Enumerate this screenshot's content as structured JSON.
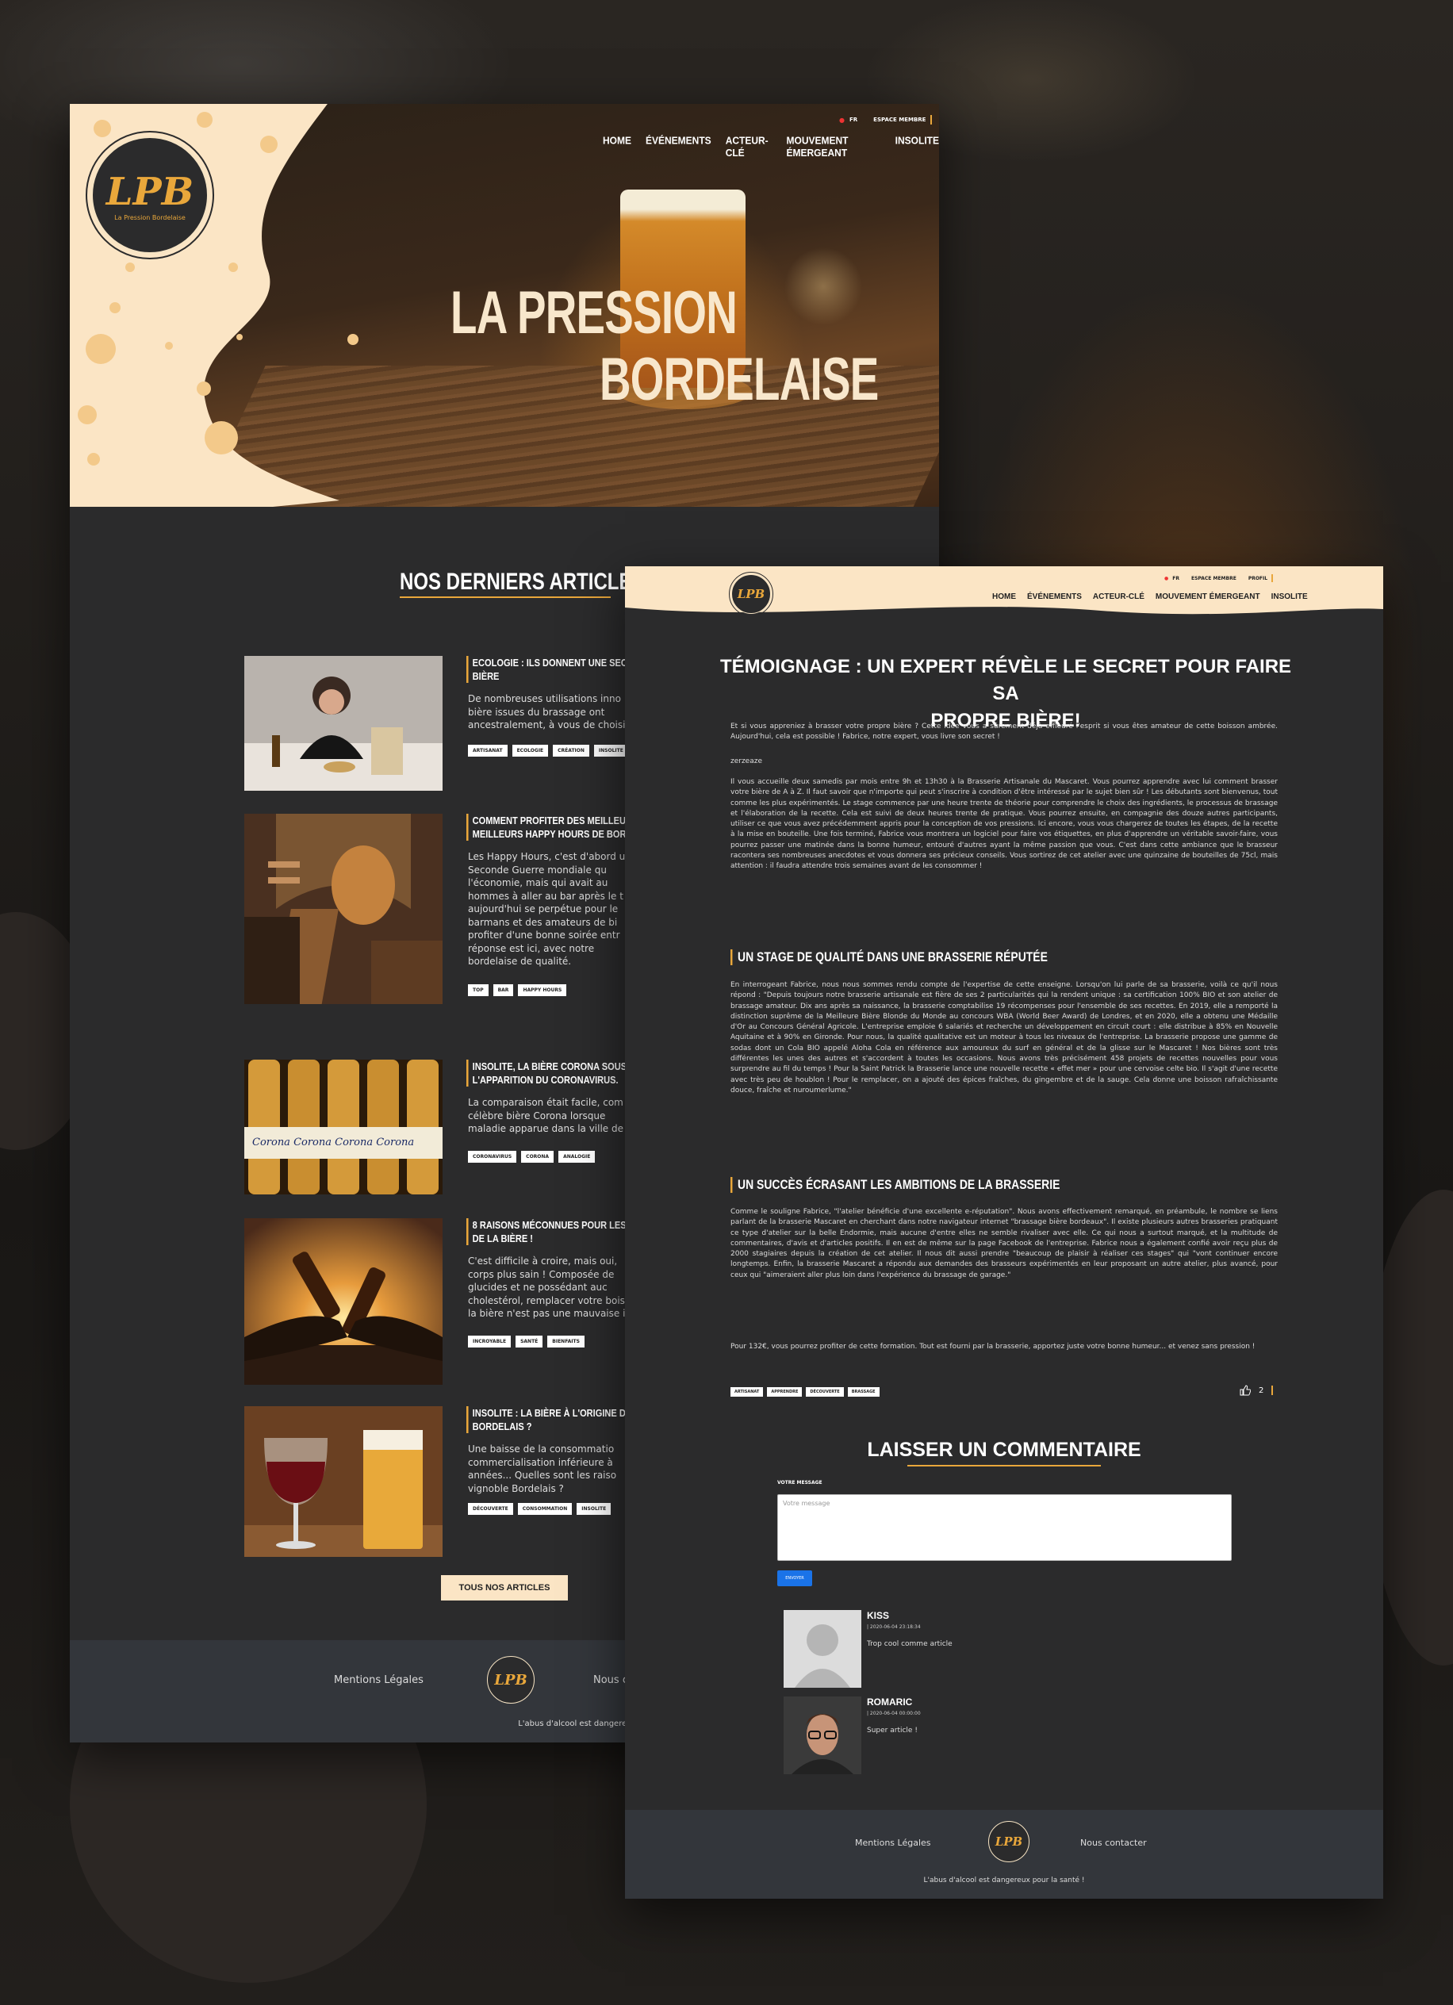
{
  "brand": {
    "logo_text": "LPB",
    "tagline": "La Pression Bordelaise"
  },
  "colors": {
    "accent": "#e9a73b",
    "cream": "#fbe5c5",
    "dark": "#2b2b2c",
    "footer": "#33363b"
  },
  "topbar": {
    "lang": "FR",
    "lang_icon": "flag-icon",
    "member": "ESPACE MEMBRE",
    "member_short": "ESPACE MEMBRE",
    "profile": "PROFIL"
  },
  "nav": [
    "HOME",
    "ÉVÉNEMENTS",
    "ACTEUR-CLÉ",
    "MOUVEMENT ÉMERGEANT",
    "INSOLITE"
  ],
  "hero": {
    "line1": "LA PRESSION",
    "line2": "BORDELAISE"
  },
  "home": {
    "section_title": "NOS DERNIERS ARTICLES",
    "articles": [
      {
        "title": "ECOLOGIE : ILS DONNENT UNE SECOND\nBIÈRE",
        "excerpt": "De nombreuses utilisations inno\nbière issues du brassage ont\nancestralement, à vous de choisir !",
        "tags": [
          "ARTISANAT",
          "ECOLOGIE",
          "CRÉATION",
          "INSOLITE"
        ]
      },
      {
        "title": "COMMENT PROFITER DES MEILLEU\nMEILLEURS HAPPY HOURS DE BOR",
        "excerpt": "Les Happy Hours, c'est d'abord u\nSeconde Guerre mondiale qu\nl'économie, mais qui avait au\nhommes à aller au bar après le t\naujourd'hui se perpétue pour le\nbarmans et des amateurs de bi\nprofiter d'une bonne soirée entr\nréponse est ici, avec notre\nbordelaise de qualité.",
        "tags": [
          "TOP",
          "BAR",
          "HAPPY HOURS"
        ]
      },
      {
        "title": "INSOLITE, LA BIÈRE CORONA SOUS\nL'APPARITION DU CORONAVIRUS.",
        "excerpt": "La comparaison était facile, com\ncélèbre bière Corona lorsque\nmaladie apparue dans la ville de W",
        "tags": [
          "CORONAVIRUS",
          "CORONA",
          "ANALOGIE"
        ]
      },
      {
        "title": "8 RAISONS MÉCONNUES POUR LES\nDE LA BIÈRE !",
        "excerpt": "C'est difficile à croire, mais oui,\ncorps plus sain ! Composée de\nglucides et ne possédant auc\ncholestérol, remplacer votre bois\nla bière n'est pas une mauvaise id",
        "tags": [
          "INCROYABLE",
          "SANTÉ",
          "BIENFAITS"
        ]
      },
      {
        "title": "INSOLITE : LA BIÈRE À L'ORIGINE D\nBORDELAIS ?",
        "excerpt": "Une baisse de la consommatio\ncommercialisation inférieure à\nannées... Quelles sont les raiso\nvignoble Bordelais ?",
        "tags": [
          "DÉCOUVERTE",
          "CONSOMMATION",
          "INSOLITE"
        ]
      }
    ],
    "all_button": "TOUS NOS ARTICLES",
    "footer": {
      "legal": "Mentions Légales",
      "contact": "Nous c",
      "warning": "L'abus d'alcool est dangereux pour la santé !"
    }
  },
  "post": {
    "title_l1": "TÉMOIGNAGE : UN EXPERT RÉVÈLE LE SECRET POUR FAIRE SA",
    "title_l2": "PROPRE BIÈRE!",
    "intro": "Et si vous appreniez à brasser votre propre bière ? Cette idée vous a sûrement déjà effleuré l'esprit si vous êtes amateur de cette boisson ambrée. Aujourd'hui, cela est possible ! Fabrice, notre expert, vous livre son secret !",
    "intro2": "zerzeaze",
    "p1": "Il vous accueille deux samedis par mois entre 9h et 13h30 à la Brasserie Artisanale du Mascaret. Vous pourrez apprendre avec lui comment brasser votre bière de A à Z. Il faut savoir que n'importe qui peut s'inscrire à condition d'être intéressé par le sujet bien sûr ! Les débutants sont bienvenus, tout comme les plus expérimentés. Le stage commence par une heure trente de théorie pour comprendre le choix des ingrédients, le processus de brassage et l'élaboration de la recette. Cela est suivi de deux heures trente de pratique. Vous pourrez ensuite, en compagnie des douze autres participants, utiliser ce que vous avez précédemment appris pour la conception de vos pressions. Ici encore, vous vous chargerez de toutes les étapes, de la recette à la mise en bouteille. Une fois terminé, Fabrice vous montrera un logiciel pour faire vos étiquettes, en plus d'apprendre un véritable savoir-faire, vous pourrez passer une matinée dans la bonne humeur, entouré d'autres ayant la même passion que vous. C'est dans cette ambiance que le brasseur racontera ses nombreuses anecdotes et vous donnera ses précieux conseils. Vous sortirez de cet atelier avec une quinzaine de bouteilles de 75cl, mais attention : il faudra attendre trois semaines avant de les consommer !",
    "h_stage": "UN STAGE DE QUALITÉ DANS UNE BRASSERIE RÉPUTÉE",
    "p2": "En interrogeant Fabrice, nous nous sommes rendu compte de l'expertise de cette enseigne. Lorsqu'on lui parle de sa brasserie, voilà ce qu'il nous répond : \"Depuis toujours notre brasserie artisanale est fière de ses 2 particularités qui la rendent unique : sa certification 100% BIO et son atelier de brassage amateur. Dix ans après sa naissance, la brasserie comptabilise 19 récompenses pour l'ensemble de ses recettes. En 2019, elle a remporté la distinction suprême de la Meilleure Bière Blonde du Monde au concours WBA (World Beer Award) de Londres, et en 2020, elle a obtenu une Médaille d'Or au Concours Général Agricole. L'entreprise emploie 6 salariés et recherche un développement en circuit court : elle distribue à 85% en Nouvelle Aquitaine et à 90% en Gironde. Pour nous, la qualité qualitative est un moteur à tous les niveaux de l'entreprise. La brasserie propose une gamme de sodas dont un Cola BIO appelé Aloha Cola en référence aux amoureux du surf en général et de la glisse sur le Mascaret ! Nos bières sont très différentes les unes des autres et s'accordent à toutes les occasions. Nous avons très précisément 458 projets de recettes nouvelles pour vous surprendre au fil du temps ! Pour la Saint Patrick la Brasserie lance une nouvelle recette « effet mer » pour une cervoise celte bio. Il s'agit d'une recette avec très peu de houblon ! Pour le remplacer, on a ajouté des épices fraîches, du gingembre et de la sauge. Cela donne une boisson rafraîchissante douce, fraîche et nuroumerlume.\"",
    "h_succes": "UN SUCCÈS ÉCRASANT LES AMBITIONS DE LA BRASSERIE",
    "p3": "Comme le souligne Fabrice, \"l'atelier bénéficie d'une excellente e-réputation\". Nous avons effectivement remarqué, en préambule, le nombre se liens parlant de la brasserie Mascaret en cherchant dans notre navigateur internet \"brassage bière bordeaux\". Il existe plusieurs autres brasseries pratiquant ce type d'atelier sur la belle Endormie, mais aucune d'entre elles ne semble rivaliser avec elle. Ce qui nous a surtout marqué, et la multitude de commentaires, d'avis et d'articles positifs. Il en est de même sur la page Facebook de l'entreprise. Fabrice nous a également confié avoir reçu plus de 2000 stagiaires depuis la création de cet atelier. Il nous dit aussi prendre \"beaucoup de plaisir à réaliser ces stages\" qui \"vont continuer encore longtemps. Enfin, la brasserie Mascaret a répondu aux demandes des brasseurs expérimentés en leur proposant un autre atelier, plus avancé, pour ceux qui \"aimeraient aller plus loin dans l'expérience du brassage de garage.\"",
    "p4": "Pour 132€, vous pourrez profiter de cette formation. Tout est fourni par la brasserie, apportez juste votre bonne humeur... et venez sans pression !",
    "tags": [
      "ARTISANAT",
      "APPRENDRE",
      "DÉCOUVERTE",
      "BRASSAGE"
    ],
    "likes": "2",
    "comment_title": "LAISSER UN COMMENTAIRE",
    "field_label": "VOTRE MESSAGE",
    "placeholder": "Votre message",
    "send": "ENVOYER",
    "comments": [
      {
        "name": "KISS",
        "date": "| 2020-06-04 23:18:34",
        "text": "Trop cool comme article"
      },
      {
        "name": "ROMARIC",
        "date": "| 2020-06-04 00:00:00",
        "text": "Super article !"
      }
    ],
    "footer": {
      "legal": "Mentions Légales",
      "contact": "Nous contacter",
      "warning": "L'abus d'alcool est dangereux pour la santé !"
    }
  }
}
